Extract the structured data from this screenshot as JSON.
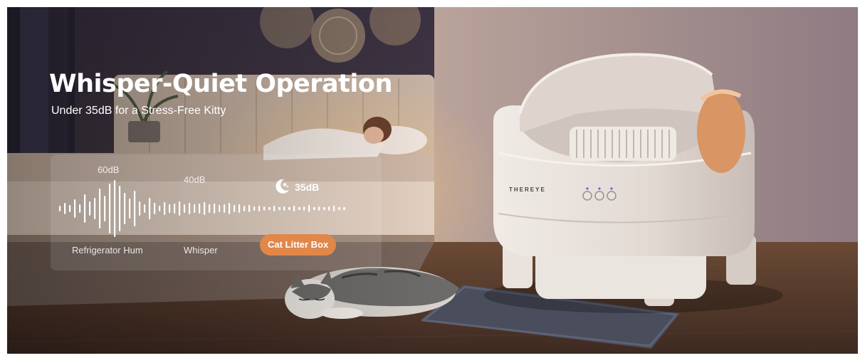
{
  "hero": {
    "headline": "Whisper-Quiet Operation",
    "subheadline": "Under 35dB for a Stress-Free Kitty"
  },
  "noise_comparison": {
    "levels": [
      {
        "db_label": "60dB",
        "caption": "Refrigerator Hum"
      },
      {
        "db_label": "40dB",
        "caption": "Whisper"
      },
      {
        "db_label": "35dB",
        "caption": "Cat Litter Box",
        "highlighted": true
      }
    ],
    "icons": [
      "sound-wave-icon",
      "moon-stars-icon"
    ]
  },
  "product": {
    "brand_label": "THEREYE"
  },
  "colors": {
    "accent": "#e1874a",
    "headline_text": "#ffffff",
    "panel": "rgba(255,255,255,0.10)"
  }
}
